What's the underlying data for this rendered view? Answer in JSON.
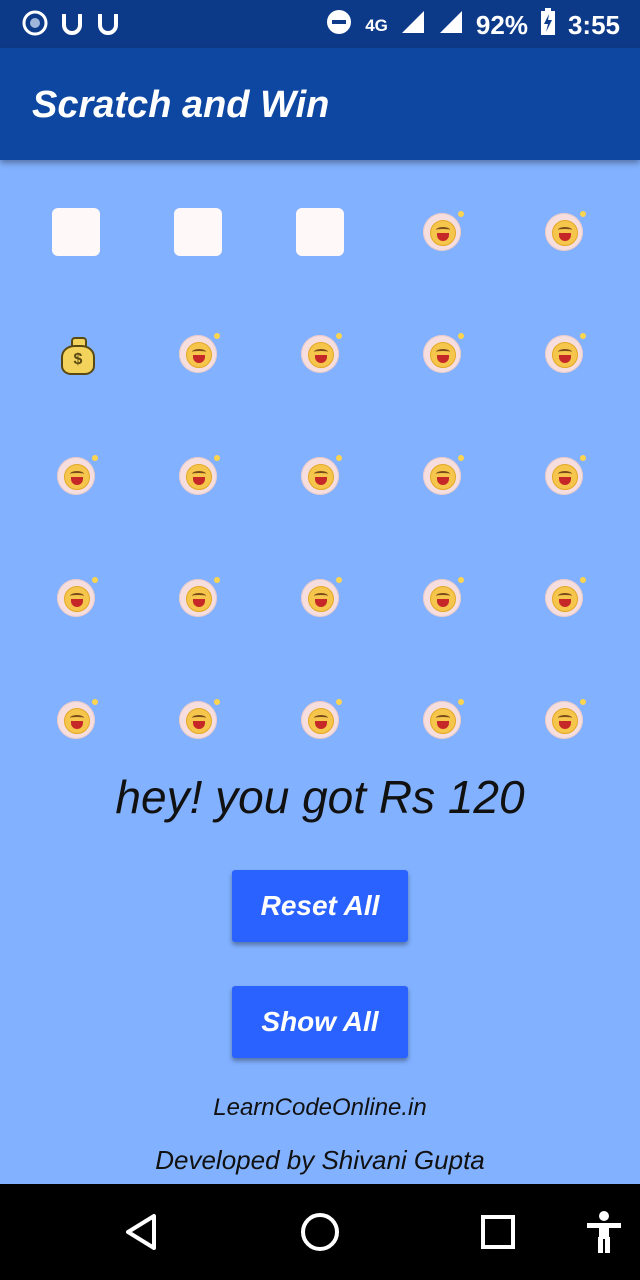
{
  "status_bar": {
    "network": "4G",
    "battery_percent": "92%",
    "time": "3:55"
  },
  "app_bar": {
    "title": "Scratch and Win"
  },
  "grid": {
    "rows": 5,
    "cols": 5,
    "cells": [
      "card",
      "card",
      "card",
      "sad-face",
      "sad-face",
      "money-bag",
      "sad-face",
      "sad-face",
      "sad-face",
      "sad-face",
      "sad-face",
      "sad-face",
      "sad-face",
      "sad-face",
      "sad-face",
      "sad-face",
      "sad-face",
      "sad-face",
      "sad-face",
      "sad-face",
      "sad-face",
      "sad-face",
      "sad-face",
      "sad-face",
      "sad-face"
    ]
  },
  "result_text": "hey! you got Rs 120",
  "buttons": {
    "reset": "Reset All",
    "show": "Show All"
  },
  "footer": {
    "site": "LearnCodeOnline.in",
    "credit": "Developed by Shivani Gupta"
  },
  "colors": {
    "status_bar": "#0d3a88",
    "app_bar": "#0d47a1",
    "background": "#82b1ff",
    "button": "#2962ff"
  }
}
